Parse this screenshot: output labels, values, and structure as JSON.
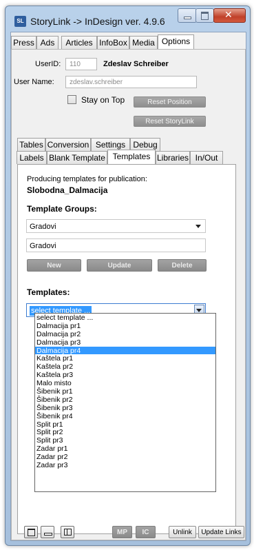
{
  "window": {
    "app_icon": "SL",
    "title": "StoryLink -> InDesign ver. 4.9.6",
    "controls": {
      "minimize": "minimize-icon",
      "maximize": "maximize-icon",
      "close": "close-icon"
    }
  },
  "main_tabs": [
    "Press",
    "Ads",
    "Articles",
    "InfoBox",
    "Media",
    "Options"
  ],
  "options": {
    "userid_label": "UserID:",
    "userid_value": "110",
    "user_fullname": "Zdeslav Schreiber",
    "username_label": "User Name:",
    "username_value": "zdeslav.schreiber",
    "stay_on_top_label": "Stay on Top",
    "stay_on_top_checked": false,
    "reset_position_label": "Reset Position",
    "reset_storylink_label": "Reset StoryLink"
  },
  "sub_tabs_row1": [
    "Tables",
    "Conversion",
    "Settings",
    "Debug"
  ],
  "sub_tabs_row2": [
    "Labels",
    "Blank Template",
    "Templates",
    "Libraries",
    "In/Out"
  ],
  "templates_panel": {
    "producing_label": "Producing templates for publication:",
    "publication": "Slobodna_Dalmacija",
    "groups_heading": "Template Groups:",
    "group_selected": "Gradovi",
    "group_name_value": "Gradovi",
    "new_label": "New",
    "update_label": "Update",
    "delete_label": "Delete",
    "templates_heading": "Templates:",
    "template_selected": "select template ...",
    "template_list": [
      "select template ...",
      "Dalmacija pr1",
      "Dalmacija pr2",
      "Dalmacija pr3",
      "Dalmacija pr4",
      "Kaštela pr1",
      "Kaštela pr2",
      "Kaštela pr3",
      "Malo misto",
      "Šibenik pr1",
      "Šibenik pr2",
      "Šibenik pr3",
      "Šibenik pr4",
      "Split pr1",
      "Split pr2",
      "Split pr3",
      "Zadar pr1",
      "Zadar pr2",
      "Zadar pr3"
    ],
    "highlighted_item": "Dalmacija pr4"
  },
  "bottom_bar": {
    "mp_label": "MP",
    "ic_label": "IC",
    "unlink_label": "Unlink",
    "update_links_label": "Update Links"
  },
  "colors": {
    "selection": "#3399ff",
    "window_frame": "#b9d1ea",
    "close_button": "#c0412a"
  }
}
